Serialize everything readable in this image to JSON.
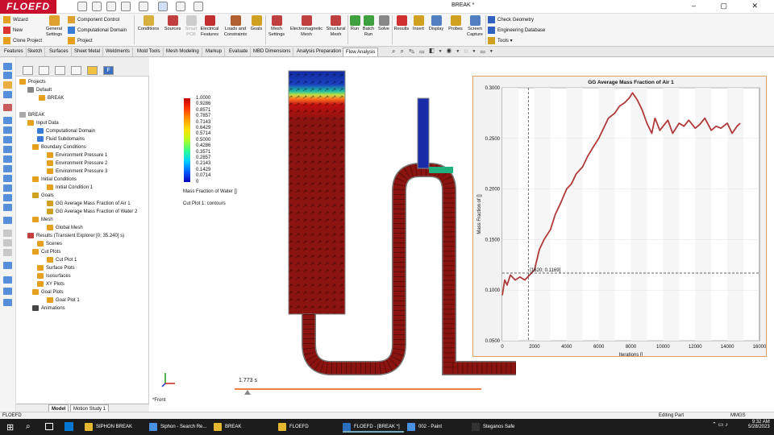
{
  "app": {
    "logo": "FLOEFD",
    "title": "BREAK *"
  },
  "ribbon": {
    "wizard": "Wizard",
    "new": "New",
    "clone_project": "Clone Project",
    "general_settings": "General Settings",
    "component_control": "Component Control",
    "computational_domain": "Computational Domain",
    "project": "Project",
    "conditions": "Conditions",
    "sources": "Sources",
    "smart_pcb": "Smart PCB",
    "electrical_features": "Electrical Features",
    "loads_constraints": "Loads and Constraints",
    "goals": "Goals",
    "mesh_settings": "Mesh Settings",
    "em_mesh": "Electromagnetic Mesh",
    "structural_mesh": "Structural Mesh",
    "run": "Run",
    "batch_run": "Batch Run",
    "solve": "Solve",
    "results": "Results",
    "insert": "Insert",
    "display": "Display",
    "probes": "Probes",
    "screen_capture": "Screen Capture",
    "check_geometry": "Check Geometry",
    "engineering_database": "Engineering Database",
    "tools": "Tools"
  },
  "tabs": [
    "Features",
    "Sketch",
    "Surfaces",
    "Sheet Metal",
    "Weldments",
    "Mold Tools",
    "Mesh Modeling",
    "Markup",
    "Evaluate",
    "MBD Dimensions",
    "Analysis Preparation",
    "Flow Analysis"
  ],
  "tree": {
    "projects": "Projects",
    "default": "Default",
    "break_config": "BREAK",
    "root": "BREAK",
    "input_data": "Input Data",
    "comp_domain": "Computational Domain",
    "fluid_subdomains": "Fluid Subdomains",
    "boundary_conditions": "Boundary Conditions",
    "env1": "Environment Pressure 1",
    "env2": "Environment Pressure 2",
    "env3": "Environment Pressure 3",
    "initial_conditions": "Initial Conditions",
    "ic1": "Initial Condition 1",
    "goals": "Goals",
    "goal_air": "GG Average Mass Fraction of Air 1",
    "goal_water": "GG Average Mass Fraction of Water 2",
    "mesh": "Mesh",
    "global_mesh": "Global Mesh",
    "results": "Results (Transient Explorer [0; 35.240] s)",
    "scenes": "Scenes",
    "cut_plots": "Cut Plots",
    "cut_plot_1": "Cut Plot 1",
    "surface_plots": "Surface Plots",
    "isosurfaces": "Isosurfaces",
    "xy_plots": "XY Plots",
    "goal_plots": "Goal Plots",
    "goal_plot_1": "Goal Plot 1",
    "animations": "Animations"
  },
  "model_tabs": [
    "Model",
    "Motion Study 1"
  ],
  "legend": {
    "ticks": [
      "1.0000",
      "0.9286",
      "0.8571",
      "0.7857",
      "0.7143",
      "0.6429",
      "0.5714",
      "0.5000",
      "0.4286",
      "0.3571",
      "0.2857",
      "0.2143",
      "0.1429",
      "0.0714",
      "0"
    ],
    "title": "Mass Fraction of Water []",
    "caption": "Cut Plot 1: contours"
  },
  "time_label": "1.773 s",
  "view_label": "*Front",
  "chart_data": {
    "type": "line",
    "title": "GG Average Mass Fraction of Air 1",
    "xlabel": "Iterations []",
    "ylabel": "Mass Fraction of []",
    "xlim": [
      0,
      16000
    ],
    "ylim": [
      0.05,
      0.3
    ],
    "xticks": [
      "0",
      "2000",
      "4000",
      "6000",
      "8000",
      "10000",
      "12000",
      "14000",
      "16000"
    ],
    "yticks": [
      "0.0500",
      "0.1000",
      "0.1500",
      "0.2000",
      "0.2500",
      "0.3000"
    ],
    "crosshair_label": "[1620; 0.1169]",
    "crosshair": [
      1620,
      0.1169
    ],
    "color": "#b03a3a",
    "series": [
      {
        "x": [
          0,
          150,
          300,
          500,
          800,
          1100,
          1400,
          1700,
          2000,
          2300,
          2600,
          3000,
          3300,
          3600,
          4000,
          4300,
          4600,
          5000,
          5300,
          5600,
          6000,
          6300,
          6600,
          7000,
          7300,
          7600,
          7900,
          8100,
          8400,
          8700,
          9000,
          9300,
          9500,
          9800,
          10000,
          10300,
          10600,
          11000,
          11300,
          11600,
          12000,
          12300,
          12600,
          13000,
          13300,
          13600,
          14000,
          14300,
          14600,
          14800
        ],
        "y": [
          0.095,
          0.11,
          0.105,
          0.115,
          0.11,
          0.113,
          0.11,
          0.115,
          0.12,
          0.14,
          0.15,
          0.16,
          0.175,
          0.185,
          0.2,
          0.205,
          0.215,
          0.222,
          0.232,
          0.24,
          0.25,
          0.26,
          0.27,
          0.275,
          0.282,
          0.285,
          0.29,
          0.295,
          0.288,
          0.278,
          0.265,
          0.255,
          0.27,
          0.258,
          0.262,
          0.268,
          0.255,
          0.265,
          0.262,
          0.268,
          0.26,
          0.264,
          0.27,
          0.258,
          0.262,
          0.26,
          0.265,
          0.255,
          0.262,
          0.265
        ]
      }
    ]
  },
  "status": {
    "left": "FLOEFD",
    "mode": "Editing Part",
    "units": "MMGS"
  },
  "taskbar": {
    "apps": [
      "SIPHON BREAK",
      "Siphon - Search Re...",
      "BREAK",
      "FLOEFD",
      "FLOEFD - [BREAK *]",
      "002 - Paint",
      "Steganos Safe"
    ],
    "time": "9:32 AM",
    "date": "5/28/2023"
  }
}
